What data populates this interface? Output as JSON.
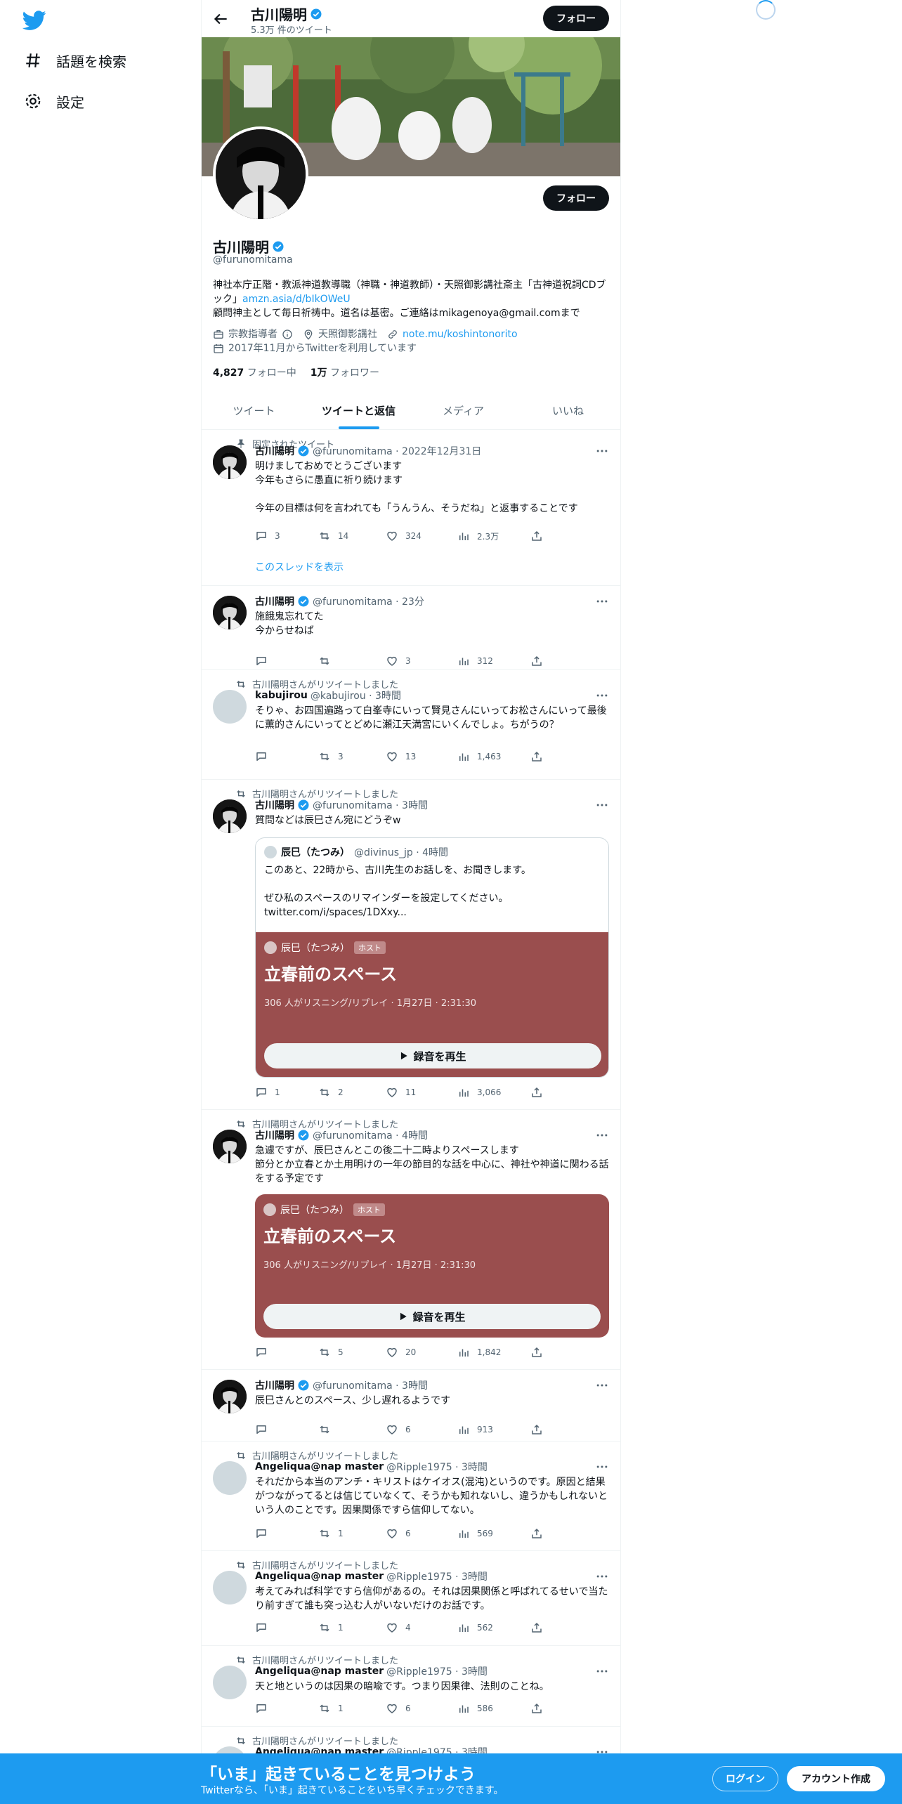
{
  "nav": {
    "explore": "話題を検索",
    "settings": "設定"
  },
  "topbar": {
    "name": "古川陽明",
    "tweet_count": "5.3万 件のツイート",
    "follow": "フォロー"
  },
  "profile": {
    "name": "古川陽明",
    "handle": "@furunomitama",
    "follow": "フォロー",
    "bio_1": "神社本庁正階・教派神道教導職（神職・神道教師）・天照御影講社斎主「古神道祝詞CDブック」",
    "bio_link": "amzn.asia/d/bIkOWeU",
    "bio_2": "顧問神主として毎日祈祷中。道名は基密。ご連絡はmikagenoya@gmail.comまで",
    "category": "宗教指導者",
    "location": "天照御影講社",
    "website": "note.mu/koshintonorito",
    "joined": "2017年11月からTwitterを利用しています",
    "following_count": "4,827",
    "following_label": "フォロー中",
    "followers_count": "1万",
    "followers_label": "フォロワー"
  },
  "tabs": [
    "ツイート",
    "ツイートと返信",
    "メディア",
    "いいね"
  ],
  "tweets": [
    {
      "social": "固定されたツイート",
      "name": "古川陽明",
      "meta": "@furunomitama · 2022年12月31日",
      "text": "明けましておめでとうございます\n今年もさらに愚直に祈り続けます\n\n今年の目標は何を言われても「うんうん、そうだね」と返事することです",
      "reply": "3",
      "rt": "14",
      "like": "324",
      "views": "2.3万",
      "thread": "このスレッドを表示"
    },
    {
      "name": "古川陽明",
      "meta": "@furunomitama · 23分",
      "text": "施餓鬼忘れてた\n今からせねば",
      "reply": "",
      "rt": "",
      "like": "3",
      "views": "312"
    },
    {
      "social": "古川陽明さんがリツイートしました",
      "name": "kabujirou",
      "meta": "@kabujirou · 3時間",
      "text": "そりゃ、お四国遍路って白峯寺にいって賢見さんにいってお松さんにいって最後に薫的さんにいってとどめに瀬江天満宮にいくんでしょ。ちがうの？",
      "reply": "",
      "rt": "3",
      "like": "13",
      "views": "1,463"
    },
    {
      "social": "古川陽明さんがリツイートしました",
      "name": "古川陽明",
      "meta": "@furunomitama · 3時間",
      "text": "質問などは辰巳さん宛にどうぞw",
      "reply": "1",
      "rt": "2",
      "like": "11",
      "views": "3,066",
      "quote": {
        "name": "辰巳（たつみ）",
        "meta": "@divinus_jp · 4時間",
        "text": "このあと、22時から、古川先生のお話しを、お聞きします。\n\nぜひ私のスペースのリマインダーを設定してください。\ntwitter.com/i/spaces/1DXxy..."
      },
      "space": {
        "host": "辰巳（たつみ）",
        "badge": "ホスト",
        "title": "立春前のスペース",
        "info": "306 人がリスニング/リプレイ · 1月27日 · 2:31:30",
        "play": "録音を再生"
      }
    },
    {
      "social": "古川陽明さんがリツイートしました",
      "name": "古川陽明",
      "meta": "@furunomitama · 4時間",
      "text": "急遽ですが、辰巳さんとこの後二十二時よりスペースします\n節分とか立春とか土用明けの一年の節目的な話を中心に、神社や神道に関わる話をする予定です",
      "reply": "",
      "rt": "5",
      "like": "20",
      "views": "1,842",
      "space": {
        "host": "辰巳（たつみ）",
        "badge": "ホスト",
        "title": "立春前のスペース",
        "info": "306 人がリスニング/リプレイ · 1月27日 · 2:31:30",
        "play": "録音を再生"
      }
    },
    {
      "name": "古川陽明",
      "meta": "@furunomitama · 3時間",
      "text": "辰巳さんとのスペース、少し遅れるようです",
      "reply": "",
      "rt": "",
      "like": "6",
      "views": "913"
    },
    {
      "social": "古川陽明さんがリツイートしました",
      "name": "Angeliqua@nap master",
      "meta": "@Ripple1975 · 3時間",
      "text": "それだから本当のアンチ・キリストはケイオス(混沌)というのです。原因と結果がつながってるとは信じていなくて、そうかも知れないし、違うかもしれないという人のことです。因果関係ですら信仰してない。",
      "reply": "",
      "rt": "1",
      "like": "6",
      "views": "569"
    },
    {
      "social": "古川陽明さんがリツイートしました",
      "name": "Angeliqua@nap master",
      "meta": "@Ripple1975 · 3時間",
      "text": "考えてみれば科学ですら信仰があるの。それは因果関係と呼ばれてるせいで当たり前すぎて誰も突っ込む人がいないだけのお話です。",
      "reply": "",
      "rt": "1",
      "like": "4",
      "views": "562"
    },
    {
      "social": "古川陽明さんがリツイートしました",
      "name": "Angeliqua@nap master",
      "meta": "@Ripple1975 · 3時間",
      "text": "天と地というのは因果の暗喩です。つまり因果律、法則のことね。",
      "reply": "",
      "rt": "1",
      "like": "6",
      "views": "586"
    },
    {
      "social": "古川陽明さんがリツイートしました",
      "name": "Angeliqua@nap master",
      "meta": "@Ripple1975 · 3時間"
    }
  ],
  "footer": {
    "title": "「いま」起きていることを見つけよう",
    "subtitle": "Twitterなら、「いま」起きていることをいち早くチェックできます。",
    "login": "ログイン",
    "signup": "アカウント作成"
  },
  "colors": {
    "accent": "#1d9bf0",
    "space_card": "#9a4e4e",
    "footer": "#1d9bf0"
  }
}
